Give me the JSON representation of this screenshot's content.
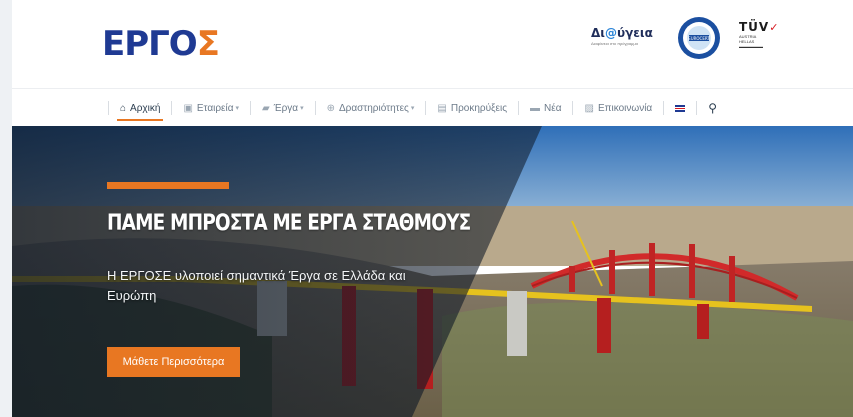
{
  "header": {
    "logo": {
      "text_main": "ΕΡΓΟ",
      "text_last": "Σ"
    },
    "badges": {
      "diavgeia": {
        "title_a": "Δι",
        "title_at": "@",
        "title_b": "ύγεια",
        "subtitle": "Διαφάνεια στο πρόγραμμα"
      },
      "eurocert": {
        "label": "EUROCERT"
      },
      "tuv": {
        "title": "TÜV",
        "lines": [
          "AUSTRIA",
          "HELLAS"
        ]
      }
    }
  },
  "nav": {
    "items": [
      {
        "label": "Αρχική",
        "icon": "home-icon",
        "active": true
      },
      {
        "label": "Εταιρεία",
        "icon": "id-card-icon",
        "caret": true
      },
      {
        "label": "Έργα",
        "icon": "folder-icon",
        "caret": true
      },
      {
        "label": "Δραστηριότητες",
        "icon": "globe-icon",
        "caret": true
      },
      {
        "label": "Προκηρύξεις",
        "icon": "document-icon"
      },
      {
        "label": "Νέα",
        "icon": "newspaper-icon"
      },
      {
        "label": "Επικοινωνία",
        "icon": "contact-icon"
      }
    ],
    "language": {
      "icon": "uk-flag-icon"
    },
    "search": {
      "icon": "search-icon"
    }
  },
  "hero": {
    "title": "ΠΑΜΕ ΜΠΡΟΣΤΑ ΜΕ ΕΡΓΑ ΣΤΑΘΜΟΥΣ",
    "subtitle": "Η ΕΡΓΟΣΕ υλοποιεί σημαντικά Έργα σε Ελλάδα και Ευρώπη",
    "button_label": "Μάθετε Περισσότερα",
    "accent_color": "#e87722"
  },
  "colors": {
    "brand_blue": "#1f3a93",
    "brand_orange": "#e87722"
  }
}
